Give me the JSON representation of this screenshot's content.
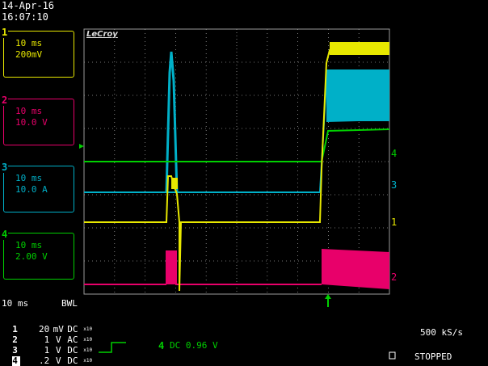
{
  "header": {
    "date": "14-Apr-16",
    "time": "16:07:10"
  },
  "brand": "LeCroy",
  "colors": {
    "ch1": "#e8e800",
    "ch2": "#e8006a",
    "ch3": "#00b0c8",
    "ch4": "#00d000",
    "grid": "#9a9a9a"
  },
  "channels": [
    {
      "num": "1",
      "timebase": "10 ms",
      "scale": "200mV"
    },
    {
      "num": "2",
      "timebase": "10 ms",
      "scale": "10.0 V"
    },
    {
      "num": "3",
      "timebase": "10 ms",
      "scale": "10.0 A"
    },
    {
      "num": "4",
      "timebase": "10 ms",
      "scale": "2.00 V"
    }
  ],
  "right_markers": [
    "4",
    "3",
    "1",
    "2"
  ],
  "footer": {
    "timebase": "10 ms",
    "bwl": "BWL",
    "rows": [
      {
        "num": "1",
        "value": "20",
        "unit": "mV",
        "coupling": "DC",
        "probe": "x10"
      },
      {
        "num": "2",
        "value": "1",
        "unit": "V",
        "coupling": "AC",
        "probe": "x10"
      },
      {
        "num": "3",
        "value": "1",
        "unit": "V",
        "coupling": "DC",
        "probe": "x10"
      },
      {
        "num": "4",
        "value": ".2",
        "unit": "V",
        "coupling": "DC",
        "probe": "x10"
      }
    ],
    "trigger_channel": "4",
    "trigger_coupling": "DC 0.96 V",
    "sample_rate": "500 kS/s",
    "status": "STOPPED"
  }
}
